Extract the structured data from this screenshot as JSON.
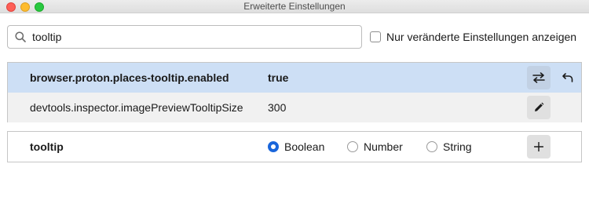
{
  "window": {
    "title": "Erweiterte Einstellungen"
  },
  "search": {
    "value": "tooltip",
    "placeholder": ""
  },
  "modified_filter": {
    "label": "Nur veränderte Einstellungen anzeigen",
    "checked": false
  },
  "preferences": [
    {
      "name": "browser.proton.places-tooltip.enabled",
      "value": "true",
      "modified": true,
      "actions": [
        "toggle-icon",
        "reset-icon"
      ]
    },
    {
      "name": "devtools.inspector.imagePreviewTooltipSize",
      "value": "300",
      "modified": false,
      "actions": [
        "edit-icon"
      ]
    }
  ],
  "new_pref": {
    "name": "tooltip",
    "types": [
      {
        "label": "Boolean",
        "selected": true
      },
      {
        "label": "Number",
        "selected": false
      },
      {
        "label": "String",
        "selected": false
      }
    ],
    "add_icon": "plus-icon"
  },
  "colors": {
    "selected_row": "#cddff5",
    "accent": "#1a66db"
  }
}
